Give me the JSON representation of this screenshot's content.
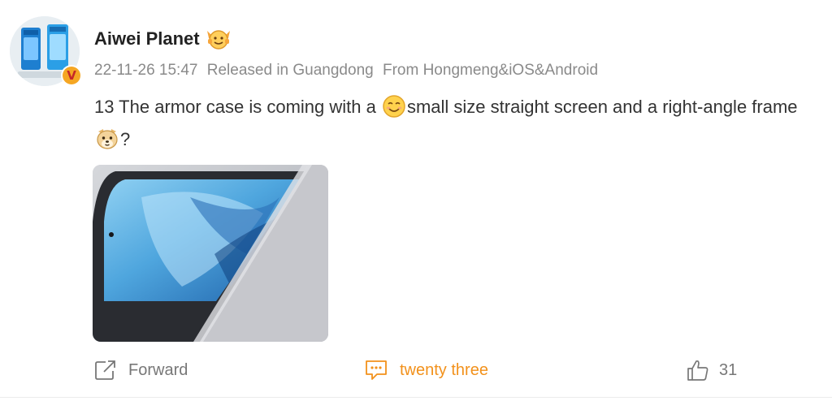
{
  "post": {
    "username": "Aiwei Planet",
    "meta": {
      "time": "22-11-26 15:47",
      "location": "Released in Guangdong",
      "source": "From Hongmeng&iOS&Android"
    },
    "content": {
      "part1": "13 The armor case is coming with a ",
      "part2": "small size straight screen and a right-angle frame ",
      "part3": "?"
    },
    "verified_mark": "V"
  },
  "actions": {
    "forward_label": "Forward",
    "comment_label": "twenty three",
    "like_count": "31"
  },
  "icons": {
    "forward": "forward-icon",
    "comment": "comment-icon",
    "like": "thumbs-up-icon",
    "badge": "emoji-badge-icon"
  },
  "colors": {
    "accent_orange": "#f2911b",
    "text_gray": "#8a8a8a",
    "text_main": "#333333",
    "verified_bg": "#f5a623"
  }
}
